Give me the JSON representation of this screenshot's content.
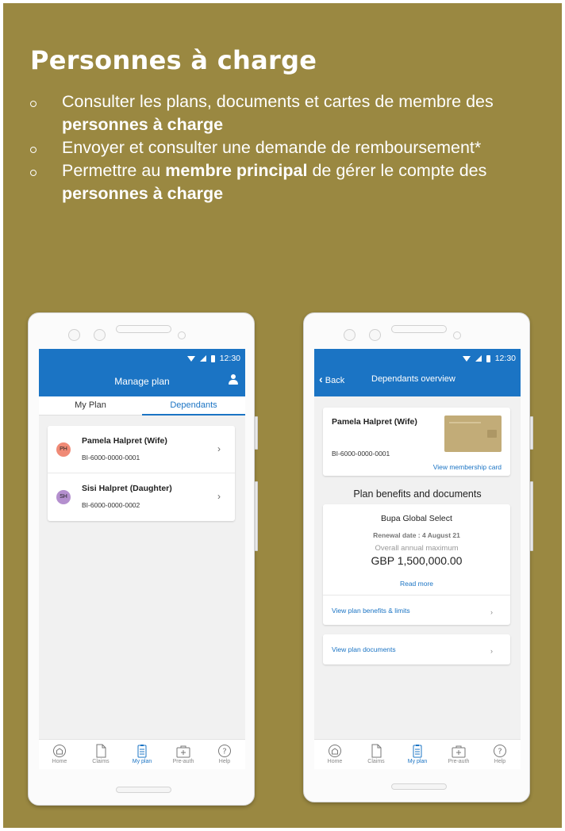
{
  "slide": {
    "title": "Personnes à charge",
    "bullets": [
      {
        "before": "Consulter les plans, documents et cartes de membre des ",
        "bold": "personnes à charge",
        "middle": "",
        "bold2": "",
        "after": ""
      },
      {
        "before": "Envoyer et consulter une demande de remboursement*",
        "bold": "",
        "middle": "",
        "bold2": "",
        "after": ""
      },
      {
        "before": "Permettre au ",
        "bold": "membre principal",
        "middle": " de gérer le compte des ",
        "bold2": "personnes à charge",
        "after": ""
      }
    ]
  },
  "colors": {
    "background": "#9a8841",
    "brand_blue": "#1b74c4"
  },
  "status_time": "12:30",
  "left_phone": {
    "title": "Manage plan",
    "tabs": [
      {
        "label": "My Plan",
        "active": false
      },
      {
        "label": "Dependants",
        "active": true
      }
    ],
    "dependants": [
      {
        "initials": "PH",
        "name": "Pamela Halpret (Wife)",
        "id": "BI-6000-0000-0001",
        "color": "#f08a76"
      },
      {
        "initials": "SH",
        "name": "Sisi Halpret (Daughter)",
        "id": "BI-6000-0000-0002",
        "color": "#b48fce"
      }
    ]
  },
  "right_phone": {
    "back_label": "Back",
    "title": "Dependants overview",
    "member_name": "Pamela Halpret (Wife)",
    "member_id": "BI-6000-0000-0001",
    "membership_link": "View membership card",
    "benefits_title": "Plan benefits and documents",
    "plan_name": "Bupa Global Select",
    "renewal": "Renewal date : 4 August 21",
    "annual_max_label": "Overall annual maximum",
    "annual_max_value": "GBP 1,500,000.00",
    "read_more": "Read more",
    "benefits_link": "View plan benefits & limits",
    "documents_link": "View plan documents"
  },
  "bottom_nav": [
    {
      "label": "Home",
      "icon": "home-icon"
    },
    {
      "label": "Claims",
      "icon": "document-icon"
    },
    {
      "label": "My plan",
      "icon": "clipboard-icon",
      "active": true
    },
    {
      "label": "Pre-auth",
      "icon": "medical-case-icon"
    },
    {
      "label": "Help",
      "icon": "help-icon"
    }
  ]
}
